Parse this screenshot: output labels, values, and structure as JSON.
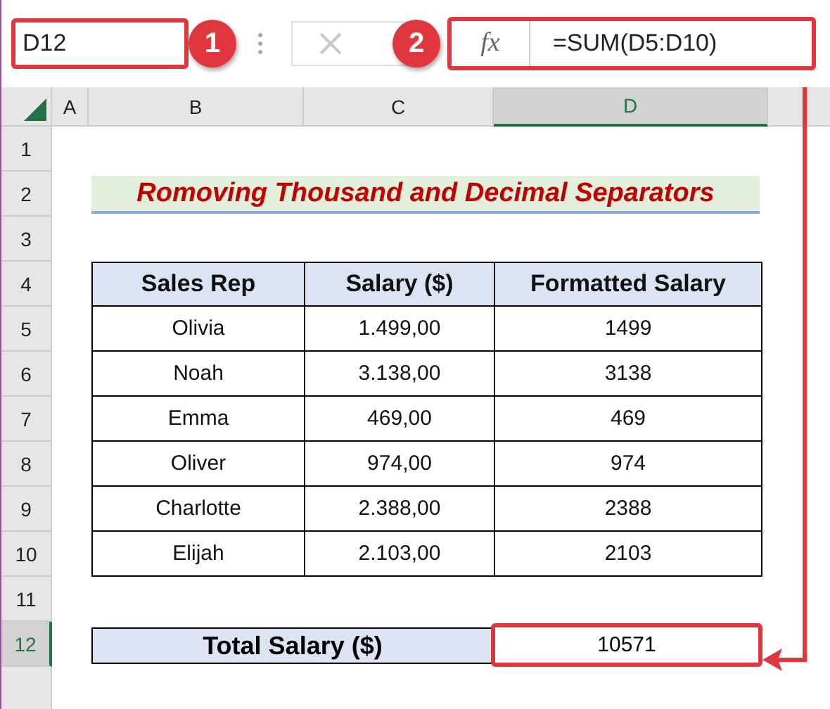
{
  "name_box": {
    "value": "D12"
  },
  "formula_bar": {
    "fx": "fx",
    "formula": "=SUM(D5:D10)"
  },
  "callouts": [
    {
      "label": "1"
    },
    {
      "label": "2"
    }
  ],
  "columns": [
    {
      "label": "A",
      "selected": false
    },
    {
      "label": "B",
      "selected": false
    },
    {
      "label": "C",
      "selected": false
    },
    {
      "label": "D",
      "selected": true
    }
  ],
  "row_numbers": [
    {
      "label": "1",
      "selected": false
    },
    {
      "label": "2",
      "selected": false
    },
    {
      "label": "3",
      "selected": false
    },
    {
      "label": "4",
      "selected": false
    },
    {
      "label": "5",
      "selected": false
    },
    {
      "label": "6",
      "selected": false
    },
    {
      "label": "7",
      "selected": false
    },
    {
      "label": "8",
      "selected": false
    },
    {
      "label": "9",
      "selected": false
    },
    {
      "label": "10",
      "selected": false
    },
    {
      "label": "11",
      "selected": false
    },
    {
      "label": "12",
      "selected": true
    }
  ],
  "title": "Romoving Thousand and Decimal Separators",
  "table": {
    "columns": [
      "Sales Rep",
      "Salary ($)",
      "Formatted Salary"
    ],
    "rows": [
      [
        "Olivia",
        "1.499,00",
        "1499"
      ],
      [
        "Noah",
        "3.138,00",
        "3138"
      ],
      [
        "Emma",
        "469,00",
        "469"
      ],
      [
        "Oliver",
        "974,00",
        "974"
      ],
      [
        "Charlotte",
        "2.388,00",
        "2388"
      ],
      [
        "Elijah",
        "2.103,00",
        "2103"
      ]
    ]
  },
  "total": {
    "label": "Total Salary ($)",
    "value": "10571"
  }
}
